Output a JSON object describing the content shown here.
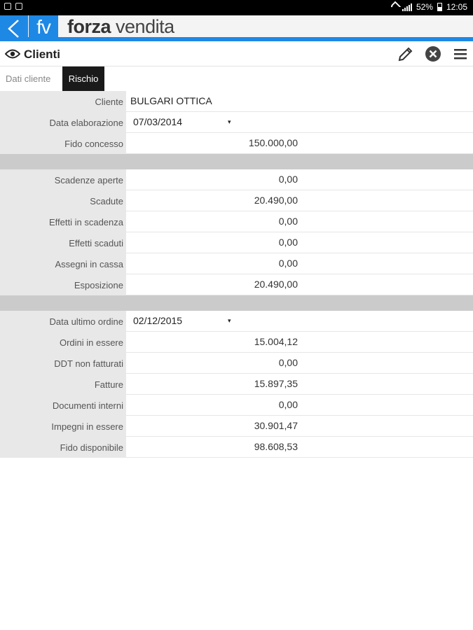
{
  "status_bar": {
    "battery": "52%",
    "time": "12:05"
  },
  "app": {
    "logo_text": "fv",
    "brand_bold": "forza",
    "brand_light": "vendita"
  },
  "page": {
    "title": "Clienti"
  },
  "tabs": [
    {
      "label": "Dati cliente",
      "active": false
    },
    {
      "label": "Rischio",
      "active": true
    }
  ],
  "sections": [
    [
      {
        "label": "Cliente",
        "value": "BULGARI OTTICA",
        "kind": "text"
      },
      {
        "label": "Data elaborazione",
        "value": "07/03/2014",
        "kind": "date"
      },
      {
        "label": "Fido concesso",
        "value": "150.000,00",
        "kind": "num"
      }
    ],
    [
      {
        "label": "Scadenze aperte",
        "value": "0,00",
        "kind": "num"
      },
      {
        "label": "Scadute",
        "value": "20.490,00",
        "kind": "num"
      },
      {
        "label": "Effetti in scadenza",
        "value": "0,00",
        "kind": "num"
      },
      {
        "label": "Effetti scaduti",
        "value": "0,00",
        "kind": "num"
      },
      {
        "label": "Assegni in cassa",
        "value": "0,00",
        "kind": "num"
      },
      {
        "label": "Esposizione",
        "value": "20.490,00",
        "kind": "num"
      }
    ],
    [
      {
        "label": "Data ultimo ordine",
        "value": "02/12/2015",
        "kind": "date"
      },
      {
        "label": "Ordini in essere",
        "value": "15.004,12",
        "kind": "num"
      },
      {
        "label": "DDT non fatturati",
        "value": "0,00",
        "kind": "num"
      },
      {
        "label": "Fatture",
        "value": "15.897,35",
        "kind": "num"
      },
      {
        "label": "Documenti interni",
        "value": "0,00",
        "kind": "num"
      },
      {
        "label": "Impegni in essere",
        "value": "30.901,47",
        "kind": "num"
      },
      {
        "label": "Fido disponibile",
        "value": "98.608,53",
        "kind": "num"
      }
    ]
  ],
  "colors": {
    "accent": "#1e88e5",
    "label_bg": "#e8e8e8",
    "separator": "#cbcbcb",
    "active_tab": "#1a1a1a"
  }
}
